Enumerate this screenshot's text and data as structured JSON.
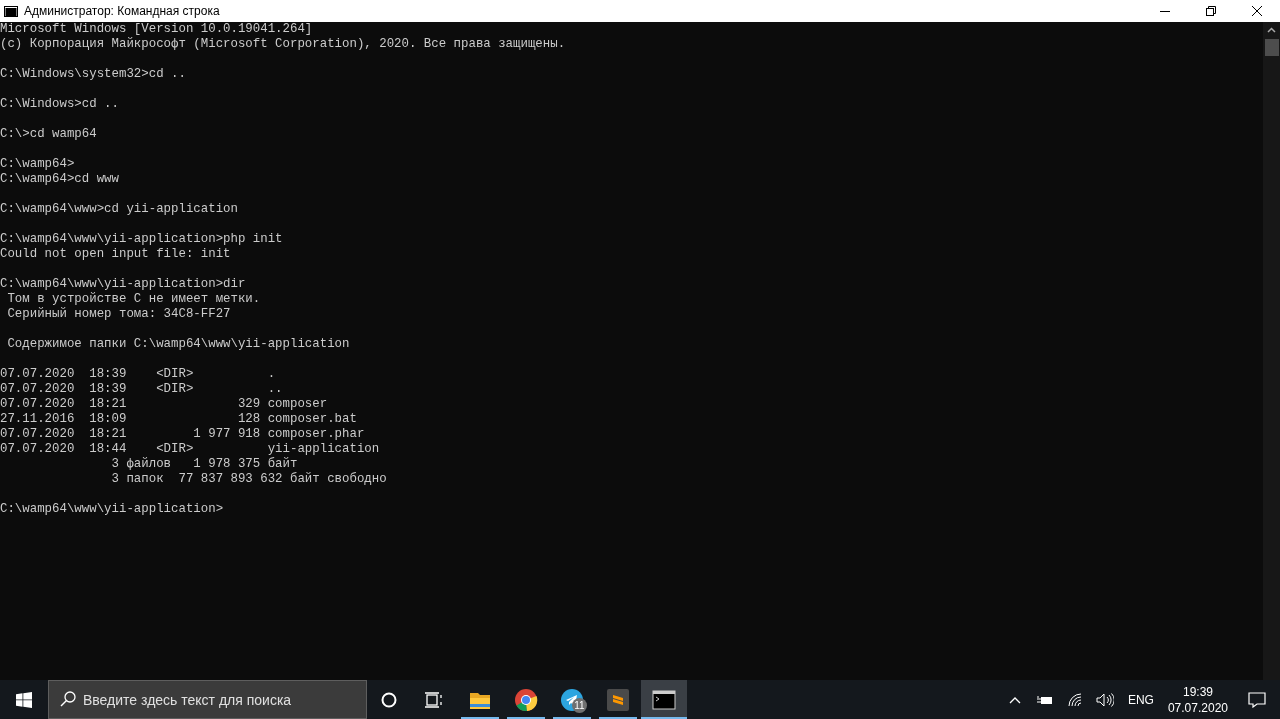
{
  "window": {
    "title": "Администратор: Командная строка"
  },
  "console": {
    "blocks": [
      [
        "Microsoft Windows [Version 10.0.19041.264]",
        "(c) Корпорация Майкрософт (Microsoft Corporation), 2020. Все права защищены."
      ],
      [
        "C:\\Windows\\system32>cd .."
      ],
      [
        "C:\\Windows>cd .."
      ],
      [
        "C:\\>cd wamp64"
      ],
      [
        "C:\\wamp64>",
        "C:\\wamp64>cd www"
      ],
      [
        "C:\\wamp64\\www>cd yii-application"
      ],
      [
        "C:\\wamp64\\www\\yii-application>php init",
        "Could not open input file: init"
      ],
      [
        "C:\\wamp64\\www\\yii-application>dir",
        " Том в устройстве C не имеет метки.",
        " Серийный номер тома: 34C8-FF27"
      ],
      [
        " Содержимое папки C:\\wamp64\\www\\yii-application"
      ],
      [
        "07.07.2020  18:39    <DIR>          .",
        "07.07.2020  18:39    <DIR>          ..",
        "07.07.2020  18:21               329 composer",
        "27.11.2016  18:09               128 composer.bat",
        "07.07.2020  18:21         1 977 918 composer.phar",
        "07.07.2020  18:44    <DIR>          yii-application",
        "               3 файлов   1 978 375 байт",
        "               3 папок  77 837 893 632 байт свободно"
      ],
      [
        "C:\\wamp64\\www\\yii-application>"
      ]
    ]
  },
  "taskbar": {
    "search": {
      "placeholder": "Введите здесь текст для поиска"
    },
    "apps": [
      {
        "kind": "folder",
        "running": true,
        "selected": false
      },
      {
        "kind": "browser",
        "running": true,
        "selected": false
      },
      {
        "kind": "messenger",
        "running": true,
        "selected": false,
        "badge": "11"
      },
      {
        "kind": "editor",
        "running": true,
        "selected": false
      },
      {
        "kind": "terminal",
        "running": true,
        "selected": true
      }
    ],
    "language": "ENG",
    "time": "19:39",
    "date": "07.07.2020"
  }
}
